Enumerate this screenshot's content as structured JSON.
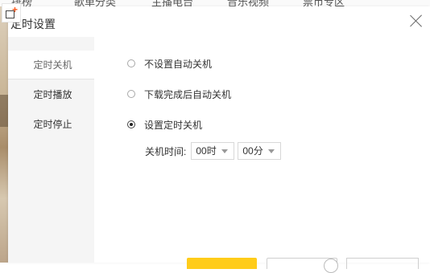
{
  "background": {
    "tabs": [
      "排榜",
      "歌单分类",
      "主播电台",
      "音乐视频",
      "票币专区"
    ]
  },
  "dialog": {
    "title": "定时设置",
    "sidebar": [
      {
        "label": "定时关机"
      },
      {
        "label": "定时播放"
      },
      {
        "label": "定时停止"
      }
    ],
    "options": [
      {
        "label": "不设置自动关机",
        "checked": false
      },
      {
        "label": "下载完成后自动关机",
        "checked": false
      },
      {
        "label": "设置定时关机",
        "checked": true
      }
    ],
    "time": {
      "label": "关机时间:",
      "hour": "00时",
      "minute": "00分"
    }
  },
  "colors": {
    "accent": "#ffcc1a",
    "sidebar_bg": "#f5f5f5"
  }
}
